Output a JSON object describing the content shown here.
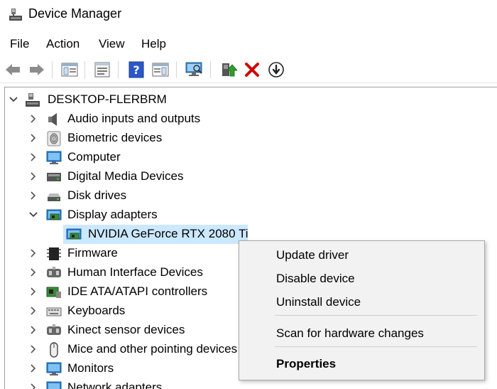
{
  "window": {
    "title": "Device Manager"
  },
  "menu": [
    "File",
    "Action",
    "View",
    "Help"
  ],
  "toolbar": {
    "buttons": [
      "back-arrow-icon",
      "forward-arrow-icon",
      "show-hide-console-tree-icon",
      "properties-icon",
      "help-icon",
      "action-pane-icon",
      "scan-hardware-icon",
      "update-driver-icon",
      "uninstall-device-icon",
      "enable-device-icon"
    ]
  },
  "tree": {
    "root": "DESKTOP-FLERBRM",
    "items": [
      {
        "label": "Audio inputs and outputs",
        "icon": "speaker-icon"
      },
      {
        "label": "Biometric devices",
        "icon": "fingerprint-icon"
      },
      {
        "label": "Computer",
        "icon": "monitor-icon"
      },
      {
        "label": "Digital Media Devices",
        "icon": "media-device-icon"
      },
      {
        "label": "Disk drives",
        "icon": "disk-drive-icon"
      },
      {
        "label": "Display adapters",
        "icon": "display-adapter-icon"
      },
      {
        "label": "NVIDIA GeForce RTX 2080 Ti",
        "icon": "display-adapter-icon"
      },
      {
        "label": "Firmware",
        "icon": "chip-icon"
      },
      {
        "label": "Human Interface Devices",
        "icon": "hid-icon"
      },
      {
        "label": "IDE ATA/ATAPI controllers",
        "icon": "controller-icon"
      },
      {
        "label": "Keyboards",
        "icon": "keyboard-icon"
      },
      {
        "label": "Kinect sensor devices",
        "icon": "sensor-icon"
      },
      {
        "label": "Mice and other pointing devices",
        "icon": "mouse-icon"
      },
      {
        "label": "Monitors",
        "icon": "monitor-icon"
      },
      {
        "label": "Network adapters",
        "icon": "network-icon"
      }
    ]
  },
  "context_menu": {
    "items": [
      "Update driver",
      "Disable device",
      "Uninstall device",
      "Scan for hardware changes",
      "Properties"
    ]
  },
  "colors": {
    "selection": "#cce8ff",
    "uninstall_red": "#d00000",
    "help_blue": "#2a57c9"
  }
}
